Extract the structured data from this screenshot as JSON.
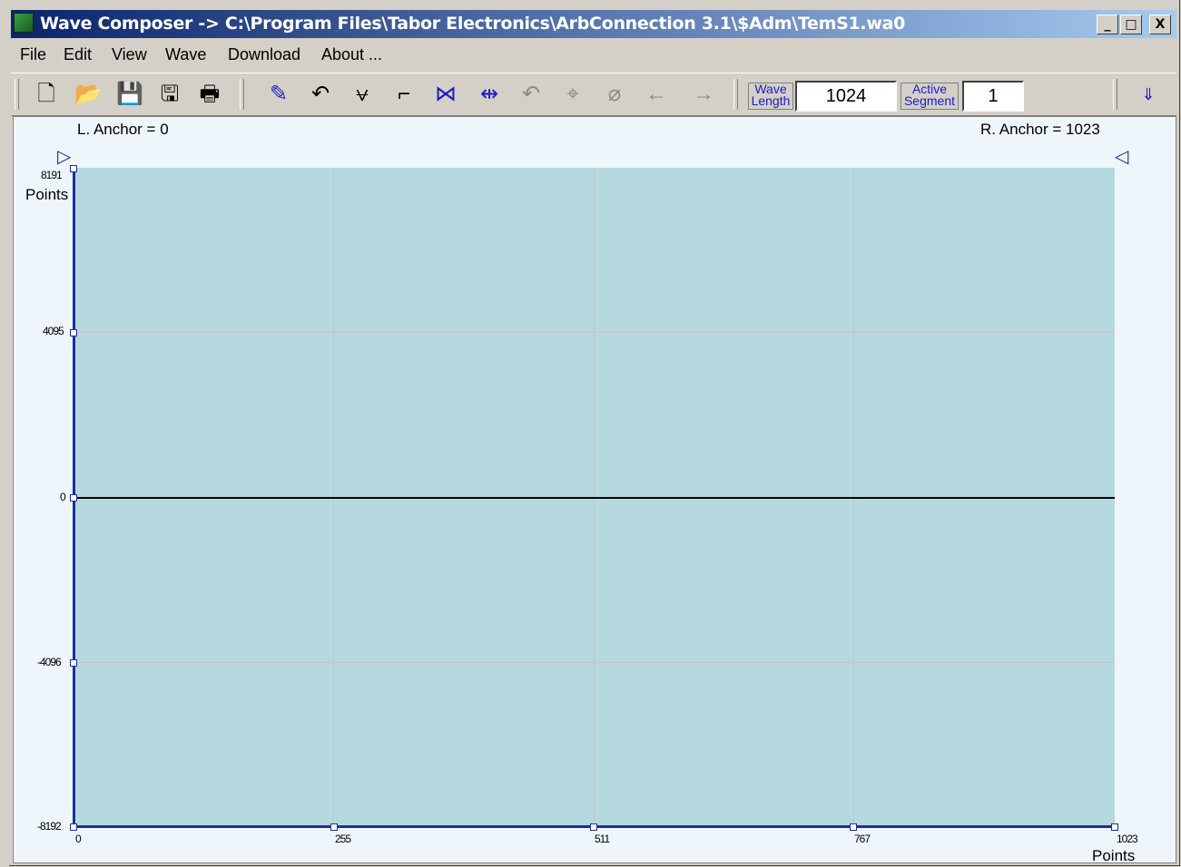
{
  "window": {
    "title": "Wave Composer -> C:\\Program Files\\Tabor Electronics\\ArbConnection 3.1\\$Adm\\TemS1.wa0",
    "minimize": "_",
    "maximize": "□",
    "close": "X"
  },
  "menu": [
    "File",
    "Edit",
    "View",
    "Wave",
    "Download",
    "About ..."
  ],
  "toolbar": {
    "file_tools": [
      "new-icon",
      "open-icon",
      "save-icon",
      "save-as-icon",
      "print-icon"
    ],
    "edit_tools": [
      "freehand-draw-icon",
      "curve-draw-icon",
      "equation-icon",
      "step-icon",
      "anchor-icon",
      "marker-icon",
      "undo-icon",
      "zoom-in-icon",
      "zoom-out-icon",
      "scroll-left-icon",
      "scroll-right-icon"
    ],
    "wave_length_label": "Wave Length",
    "wave_length_value": "1024",
    "active_segment_label": "Active Segment",
    "active_segment_value": "1",
    "download_icon": "download-icon"
  },
  "canvas": {
    "left_anchor": "L. Anchor = 0",
    "right_anchor": "R. Anchor = 1023",
    "y_unit": "Points",
    "x_unit": "Points",
    "y_ticks": [
      "8191",
      "4095",
      "0",
      "-4096",
      "-8192"
    ],
    "x_ticks": [
      "0",
      "255",
      "511",
      "767",
      "1023"
    ]
  },
  "chart_data": {
    "type": "line",
    "xlabel": "Points",
    "ylabel": "Points",
    "xlim": [
      0,
      1023
    ],
    "ylim": [
      -8192,
      8191
    ],
    "series": [
      {
        "x": [
          0,
          1023
        ],
        "values": [
          0,
          0
        ]
      }
    ],
    "grid": true
  },
  "colors": {
    "plot_background": "#b5d9de",
    "axis": "#1a2ea0",
    "title_gradient_start": "#0a246a"
  }
}
